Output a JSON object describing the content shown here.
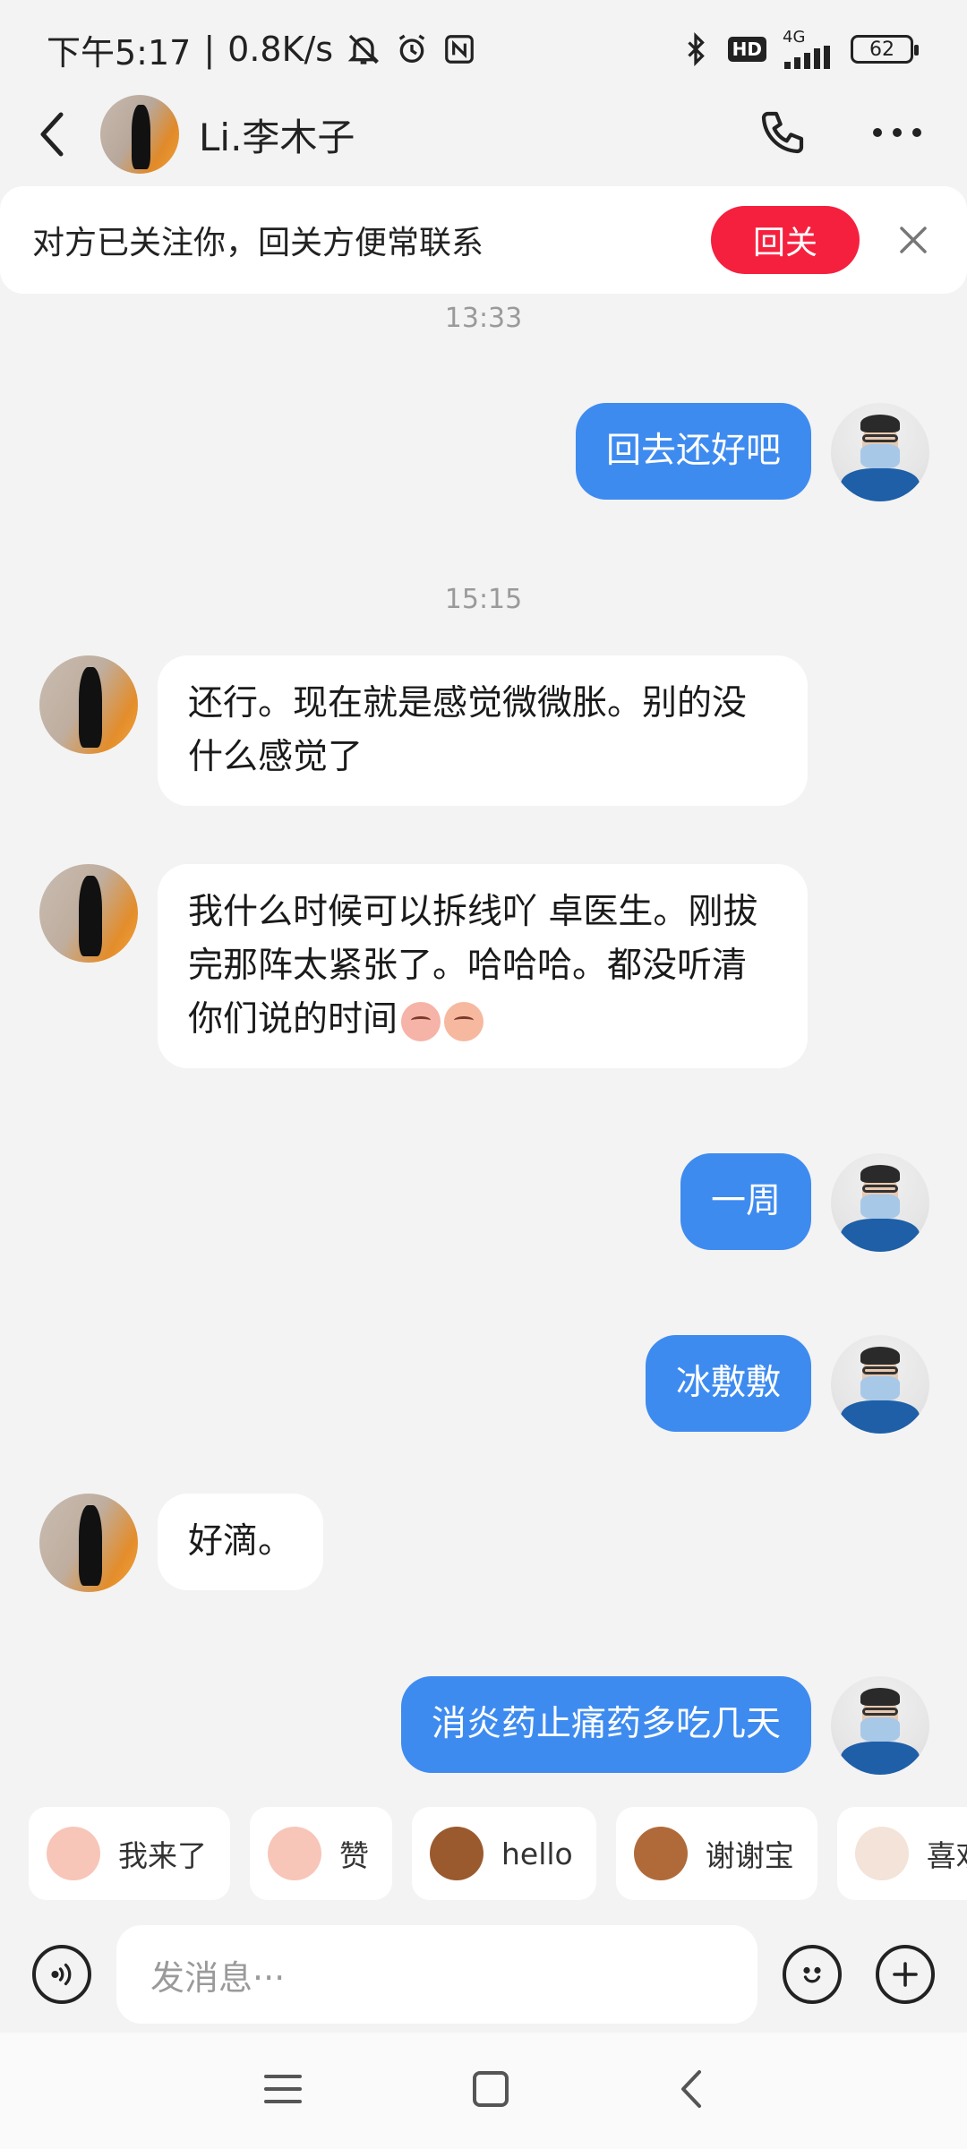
{
  "status_bar": {
    "time": "下午5:17",
    "speed": "0.8K/s",
    "network": "4G",
    "hd": "HD",
    "battery": "62",
    "icons": [
      "mute-bell-icon",
      "alarm-icon",
      "nfc-icon",
      "bluetooth-icon",
      "signal-icon",
      "battery-icon"
    ]
  },
  "header": {
    "contact_name": "Li.李木子",
    "icons": [
      "back-icon",
      "phone-icon",
      "more-icon"
    ]
  },
  "follow_banner": {
    "text": "对方已关注你，回关方便常联系",
    "button": "回关",
    "accent": "#f5203e"
  },
  "timestamps": [
    "13:33",
    "15:15"
  ],
  "messages": [
    {
      "side": "out",
      "text": "回去还好吧"
    },
    {
      "side": "in",
      "text": "还行。现在就是感觉微微胀。别的没什么感觉了"
    },
    {
      "side": "in",
      "text": "我什么时候可以拆线吖 卓医生。刚拔完那阵太紧张了。哈哈哈。都没听清你们说的时间"
    },
    {
      "side": "out",
      "text": "一周"
    },
    {
      "side": "out",
      "text": "冰敷敷"
    },
    {
      "side": "in",
      "text": "好滴。"
    },
    {
      "side": "out",
      "text": "消炎药止痛药多吃几天"
    }
  ],
  "quick_stickers": [
    {
      "label": "我来了",
      "icon": "sticker-icon"
    },
    {
      "label": "赞",
      "icon": "sticker-icon"
    },
    {
      "label": "hello",
      "icon": "monkey-sticker-icon"
    },
    {
      "label": "谢谢宝",
      "icon": "sticker-icon"
    },
    {
      "label": "喜欢",
      "icon": "sticker-icon"
    }
  ],
  "input": {
    "placeholder": "发消息···"
  },
  "colors": {
    "outgoing_bubble": "#3e8bf0",
    "incoming_bubble": "#ffffff",
    "background": "#f3f3f3"
  }
}
